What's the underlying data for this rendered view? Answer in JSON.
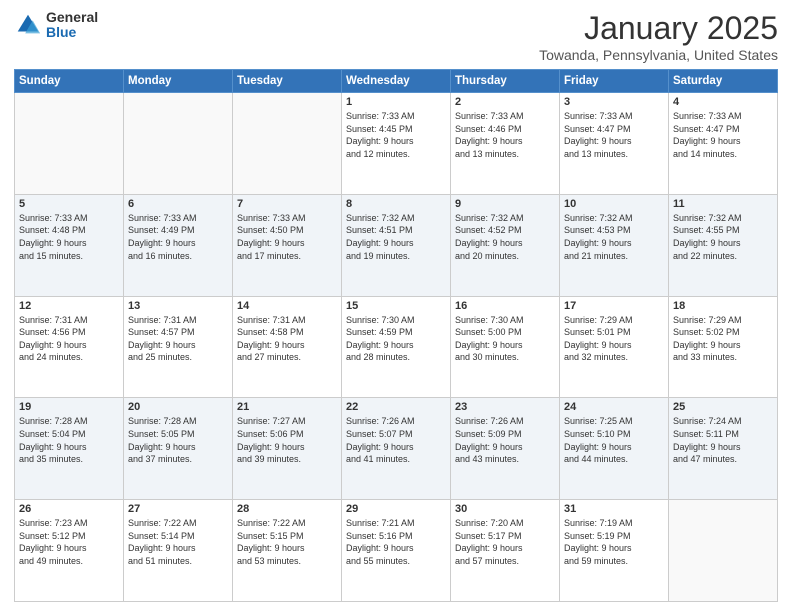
{
  "header": {
    "logo_general": "General",
    "logo_blue": "Blue",
    "month_title": "January 2025",
    "location": "Towanda, Pennsylvania, United States"
  },
  "weekdays": [
    "Sunday",
    "Monday",
    "Tuesday",
    "Wednesday",
    "Thursday",
    "Friday",
    "Saturday"
  ],
  "weeks": [
    [
      {
        "day": "",
        "info": ""
      },
      {
        "day": "",
        "info": ""
      },
      {
        "day": "",
        "info": ""
      },
      {
        "day": "1",
        "info": "Sunrise: 7:33 AM\nSunset: 4:45 PM\nDaylight: 9 hours\nand 12 minutes."
      },
      {
        "day": "2",
        "info": "Sunrise: 7:33 AM\nSunset: 4:46 PM\nDaylight: 9 hours\nand 13 minutes."
      },
      {
        "day": "3",
        "info": "Sunrise: 7:33 AM\nSunset: 4:47 PM\nDaylight: 9 hours\nand 13 minutes."
      },
      {
        "day": "4",
        "info": "Sunrise: 7:33 AM\nSunset: 4:47 PM\nDaylight: 9 hours\nand 14 minutes."
      }
    ],
    [
      {
        "day": "5",
        "info": "Sunrise: 7:33 AM\nSunset: 4:48 PM\nDaylight: 9 hours\nand 15 minutes."
      },
      {
        "day": "6",
        "info": "Sunrise: 7:33 AM\nSunset: 4:49 PM\nDaylight: 9 hours\nand 16 minutes."
      },
      {
        "day": "7",
        "info": "Sunrise: 7:33 AM\nSunset: 4:50 PM\nDaylight: 9 hours\nand 17 minutes."
      },
      {
        "day": "8",
        "info": "Sunrise: 7:32 AM\nSunset: 4:51 PM\nDaylight: 9 hours\nand 19 minutes."
      },
      {
        "day": "9",
        "info": "Sunrise: 7:32 AM\nSunset: 4:52 PM\nDaylight: 9 hours\nand 20 minutes."
      },
      {
        "day": "10",
        "info": "Sunrise: 7:32 AM\nSunset: 4:53 PM\nDaylight: 9 hours\nand 21 minutes."
      },
      {
        "day": "11",
        "info": "Sunrise: 7:32 AM\nSunset: 4:55 PM\nDaylight: 9 hours\nand 22 minutes."
      }
    ],
    [
      {
        "day": "12",
        "info": "Sunrise: 7:31 AM\nSunset: 4:56 PM\nDaylight: 9 hours\nand 24 minutes."
      },
      {
        "day": "13",
        "info": "Sunrise: 7:31 AM\nSunset: 4:57 PM\nDaylight: 9 hours\nand 25 minutes."
      },
      {
        "day": "14",
        "info": "Sunrise: 7:31 AM\nSunset: 4:58 PM\nDaylight: 9 hours\nand 27 minutes."
      },
      {
        "day": "15",
        "info": "Sunrise: 7:30 AM\nSunset: 4:59 PM\nDaylight: 9 hours\nand 28 minutes."
      },
      {
        "day": "16",
        "info": "Sunrise: 7:30 AM\nSunset: 5:00 PM\nDaylight: 9 hours\nand 30 minutes."
      },
      {
        "day": "17",
        "info": "Sunrise: 7:29 AM\nSunset: 5:01 PM\nDaylight: 9 hours\nand 32 minutes."
      },
      {
        "day": "18",
        "info": "Sunrise: 7:29 AM\nSunset: 5:02 PM\nDaylight: 9 hours\nand 33 minutes."
      }
    ],
    [
      {
        "day": "19",
        "info": "Sunrise: 7:28 AM\nSunset: 5:04 PM\nDaylight: 9 hours\nand 35 minutes."
      },
      {
        "day": "20",
        "info": "Sunrise: 7:28 AM\nSunset: 5:05 PM\nDaylight: 9 hours\nand 37 minutes."
      },
      {
        "day": "21",
        "info": "Sunrise: 7:27 AM\nSunset: 5:06 PM\nDaylight: 9 hours\nand 39 minutes."
      },
      {
        "day": "22",
        "info": "Sunrise: 7:26 AM\nSunset: 5:07 PM\nDaylight: 9 hours\nand 41 minutes."
      },
      {
        "day": "23",
        "info": "Sunrise: 7:26 AM\nSunset: 5:09 PM\nDaylight: 9 hours\nand 43 minutes."
      },
      {
        "day": "24",
        "info": "Sunrise: 7:25 AM\nSunset: 5:10 PM\nDaylight: 9 hours\nand 44 minutes."
      },
      {
        "day": "25",
        "info": "Sunrise: 7:24 AM\nSunset: 5:11 PM\nDaylight: 9 hours\nand 47 minutes."
      }
    ],
    [
      {
        "day": "26",
        "info": "Sunrise: 7:23 AM\nSunset: 5:12 PM\nDaylight: 9 hours\nand 49 minutes."
      },
      {
        "day": "27",
        "info": "Sunrise: 7:22 AM\nSunset: 5:14 PM\nDaylight: 9 hours\nand 51 minutes."
      },
      {
        "day": "28",
        "info": "Sunrise: 7:22 AM\nSunset: 5:15 PM\nDaylight: 9 hours\nand 53 minutes."
      },
      {
        "day": "29",
        "info": "Sunrise: 7:21 AM\nSunset: 5:16 PM\nDaylight: 9 hours\nand 55 minutes."
      },
      {
        "day": "30",
        "info": "Sunrise: 7:20 AM\nSunset: 5:17 PM\nDaylight: 9 hours\nand 57 minutes."
      },
      {
        "day": "31",
        "info": "Sunrise: 7:19 AM\nSunset: 5:19 PM\nDaylight: 9 hours\nand 59 minutes."
      },
      {
        "day": "",
        "info": ""
      }
    ]
  ]
}
